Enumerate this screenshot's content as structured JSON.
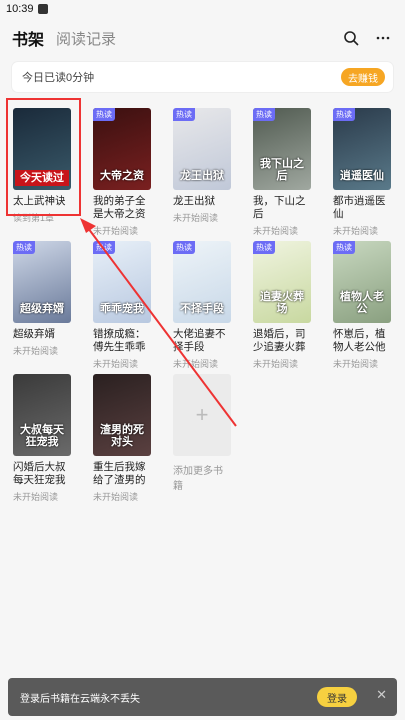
{
  "status": {
    "time": "10:39"
  },
  "header": {
    "tab_active": "书架",
    "tab_history": "阅读记录"
  },
  "reading": {
    "text": "今日已读0分钟",
    "button": "去赚钱"
  },
  "books": [
    {
      "title": "太上武神诀",
      "status": "读到第1章",
      "cover_text": "今天读过",
      "badge": "",
      "color1": "#1a2a3a",
      "color2": "#3a5a6a"
    },
    {
      "title": "我的弟子全是大帝之资",
      "status": "未开始阅读",
      "cover_text": "大帝之资",
      "badge": "热读",
      "color1": "#3a1010",
      "color2": "#7a2020"
    },
    {
      "title": "龙王出狱",
      "status": "未开始阅读",
      "cover_text": "龙王出狱",
      "badge": "热读",
      "color1": "#e8e8ea",
      "color2": "#c0c8d8"
    },
    {
      "title": "我，下山之后",
      "status": "未开始阅读",
      "cover_text": "我下山之后",
      "badge": "热读",
      "color1": "#505a50",
      "color2": "#a0a8a0"
    },
    {
      "title": "都市逍遥医仙",
      "status": "未开始阅读",
      "cover_text": "逍遥医仙",
      "badge": "热读",
      "color1": "#2a3a4a",
      "color2": "#5a7a8a"
    },
    {
      "title": "超级弃婿",
      "status": "未开始阅读",
      "cover_text": "超级弃婿",
      "badge": "热读",
      "color1": "#cfd8e8",
      "color2": "#6a7a9a"
    },
    {
      "title": "错撩成瘾：傅先生乖乖宠我",
      "status": "未开始阅读",
      "cover_text": "乖乖宠我",
      "badge": "热读",
      "color1": "#e8f0f8",
      "color2": "#b8c8e0"
    },
    {
      "title": "大佬追妻不择手段",
      "status": "未开始阅读",
      "cover_text": "不择手段",
      "badge": "热读",
      "color1": "#eef4f8",
      "color2": "#c8d8e8"
    },
    {
      "title": "退婚后，司少追妻火葬场！",
      "status": "未开始阅读",
      "cover_text": "追妻火葬场",
      "badge": "热读",
      "color1": "#f0f4e0",
      "color2": "#c8d8a0"
    },
    {
      "title": "怀崽后，植物人老公他不装了",
      "status": "未开始阅读",
      "cover_text": "植物人老公",
      "badge": "热读",
      "color1": "#c8d8c0",
      "color2": "#8aa080"
    },
    {
      "title": "闪婚后大叔每天狂宠我",
      "status": "未开始阅读",
      "cover_text": "大叔每天狂宠我",
      "badge": "",
      "color1": "#3a3a3a",
      "color2": "#6a6a6a"
    },
    {
      "title": "重生后我嫁给了渣男的死对头",
      "status": "未开始阅读",
      "cover_text": "渣男的死对头",
      "badge": "",
      "color1": "#2a2020",
      "color2": "#5a4040"
    }
  ],
  "add_book": {
    "label": "添加更多书籍",
    "plus": "+"
  },
  "login_bar": {
    "text": "登录后书籍在云端永不丢失",
    "button": "登录",
    "close": "✕"
  },
  "colors": {
    "accent": "#f6a623",
    "highlight": "#e33333",
    "badge": "#6c6cf5"
  }
}
